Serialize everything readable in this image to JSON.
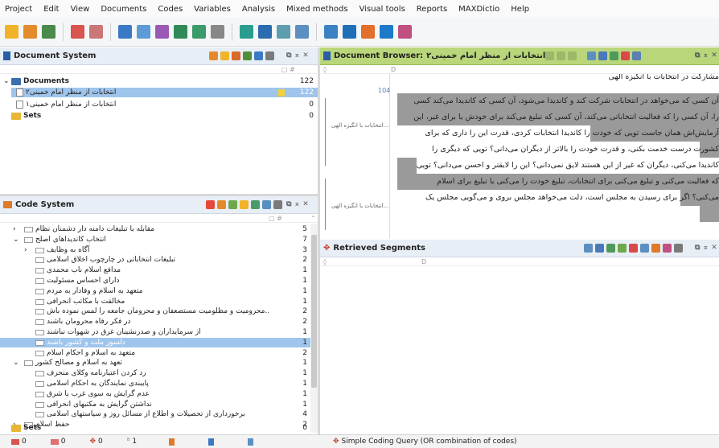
{
  "menu": [
    "Project",
    "Edit",
    "View",
    "Documents",
    "Codes",
    "Variables",
    "Analysis",
    "Mixed methods",
    "Visual tools",
    "Reports",
    "MAXDictio",
    "Help"
  ],
  "doc_system": {
    "title": "Document System",
    "documents_label": "Documents",
    "documents_count": "122",
    "doc1_label": "انتخابات از منظر امام خمینی۲",
    "doc1_count": "122",
    "doc2_label": "انتخابات از منظر امام خمینی۱",
    "doc2_count": "0",
    "sets_label": "Sets",
    "sets_count": "0"
  },
  "code_system": {
    "title": "Code System",
    "rows": [
      {
        "label": "مقابله با تبلیغات دامنه دار دشمنان نظام",
        "count": "5"
      },
      {
        "label": "انتخاب کاندیداهای اصلح",
        "count": "7"
      },
      {
        "label": "آگاه به وظایف",
        "count": "3"
      },
      {
        "label": "تبلیغات انتخاباتی در چارچوب اخلاق اسلامی",
        "count": "2"
      },
      {
        "label": "مدافع اسلام ناب محمدی",
        "count": "1"
      },
      {
        "label": "دارای احساس مسئولیت",
        "count": "1"
      },
      {
        "label": "متعهد به اسلام و وفادار به مردم",
        "count": "1"
      },
      {
        "label": "مخالفت با مکاتب انحرافی",
        "count": "1"
      },
      {
        "label": "..محرومیت و مظلومیت مستضعفان و محرومان جامعه را لمس نموده باش",
        "count": "2"
      },
      {
        "label": "در فکر رفاه محرومان باشند",
        "count": "2"
      },
      {
        "label": "از سرمایداران و صدرنشینان غرق در شهوات نباشند",
        "count": "1"
      },
      {
        "label": "دلسوز ملت و کشور باشند",
        "count": "1"
      },
      {
        "label": "متعهد به اسلام و احکام اسلام",
        "count": "2"
      },
      {
        "label": "تعهد به اسلام و مصالح کشور",
        "count": "1"
      },
      {
        "label": "رد کردن اعتبارنامه  وکلای منحرف",
        "count": "1"
      },
      {
        "label": "پایبندی نمایندگان به احکام اسلامی",
        "count": "1"
      },
      {
        "label": "عدم گرایش به سوی غرب یا شرق",
        "count": "1"
      },
      {
        "label": "نداشتن گرایش به مکتبهای انحرافی",
        "count": "1"
      },
      {
        "label": "برخورداری از تحصیلات و اطلاع از مسائل روز و سیاستهای اسلامی",
        "count": "4"
      },
      {
        "label": "حفظ اسلام",
        "count": "2"
      }
    ],
    "sets_label": "Sets",
    "sets_count": "0"
  },
  "doc_browser": {
    "title": "Document Browser:",
    "doc_name": "انتخابات از منظر امام خمینی۲",
    "para_num": "104",
    "code_label": "انتخابات با انگیزه الهی...",
    "lines": [
      "مشارکت در انتخابات با انگیزه الهی",
      "آن کسی که می‌خواهد در انتخابات شرکت کند و کاندیدا می‌شود، آن کسی که کاندیدا می‌کند کسی",
      "را، آن کسی را که فعالیت انتخاباتی می‌کند، آن کسی که تبلیغ می‌کند برای خودش یا برای غیر، این",
      "آزمایش‌اش همان جاست تویی که خودت را کاندیدا انتخابات کردی، قدرت این را داری که برای",
      "کشورت درست خدمت بکنی، و قدرت خودت را بالاتر از دیگران می‌دانی؟ تویی که دیگری را",
      "کاندیدا می‌کنی، دیگران که غیر از این هستند لایق نمی‌دانی؟ این را لایقتر و احسن می‌دانی؟ تویی",
      "که فعالیت می‌کنی و تبلیغ می‌کنی برای انتخابات، تبلیغ خودت را می‌کنی یا تبلیغ برای اسلام",
      "می‌کنی؟ اگر برای رسیدن به مجلس است، دلت می‌خواهد مجلس بروی و می‌گویی مجلس یک"
    ]
  },
  "retrieved": {
    "title": "Retrieved Segments"
  },
  "status": {
    "s1": "0",
    "s2": "0",
    "s3": "0",
    "s4": "1",
    "query": "Simple Coding Query (OR combination of codes)"
  }
}
